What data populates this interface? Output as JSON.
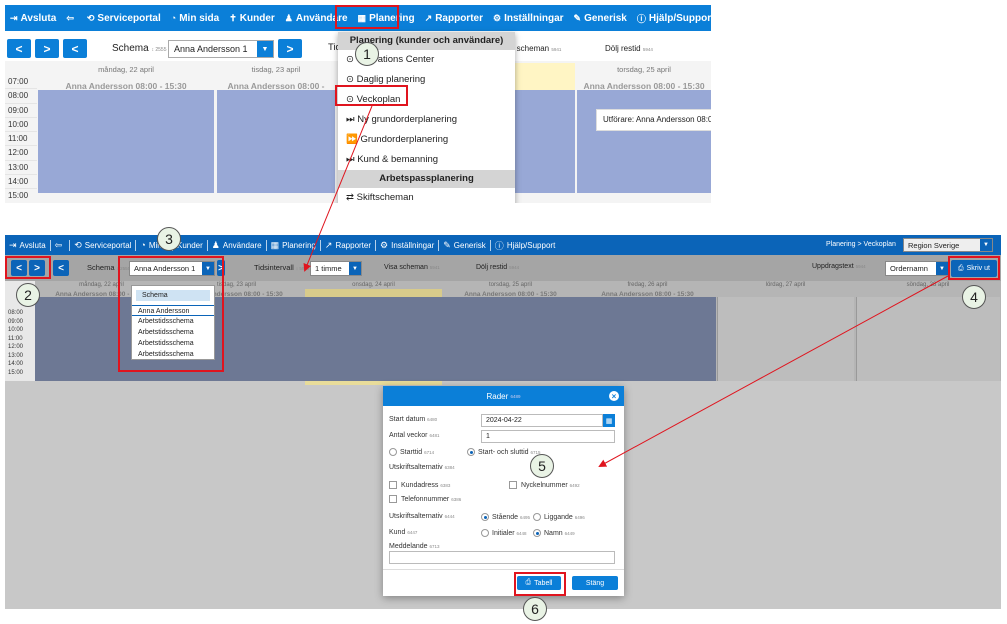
{
  "top": {
    "nav": [
      {
        "icon": "sign-out-icon",
        "glyph": "⇥",
        "label": "Avsluta"
      },
      {
        "icon": "back-arrow-icon",
        "glyph": "⇦",
        "label": ""
      },
      {
        "icon": "portal-icon",
        "glyph": "⟲",
        "label": "Serviceportal"
      },
      {
        "icon": "dashboard-icon",
        "glyph": "◔",
        "label": "Min sida"
      },
      {
        "icon": "customer-icon",
        "glyph": "✝",
        "label": "Kunder"
      },
      {
        "icon": "user-icon",
        "glyph": "♟",
        "label": "Användare"
      },
      {
        "icon": "calendar-icon",
        "glyph": "▦",
        "label": "Planering"
      },
      {
        "icon": "chart-icon",
        "glyph": "↗",
        "label": "Rapporter"
      },
      {
        "icon": "cogs-icon",
        "glyph": "⚙",
        "label": "Inställningar"
      },
      {
        "icon": "wrench-icon",
        "glyph": "✎",
        "label": "Generisk"
      },
      {
        "icon": "info-icon",
        "glyph": "ⓘ",
        "label": "Hjälp/Support"
      }
    ],
    "schema_label": "Schema",
    "schema_code": "2555",
    "schema_value": "Anna Andersson 1",
    "tids_partial": "Tids",
    "visa_partial": "a scheman",
    "visa_code": "5941",
    "dolj_label": "Dölj restid",
    "dolj_code": "5944",
    "days": [
      {
        "date": "måndag, 22 april",
        "name": "Anna Andersson 08:00 - 15:30"
      },
      {
        "date": "tisdag, 23 april",
        "name": "Anna Andersson 08:00 - 15:30"
      },
      {
        "date": "",
        "name": "0 - 15:30"
      },
      {
        "date": "torsdag, 25 april",
        "name": "Anna Andersson 08:00 - 15:30"
      }
    ],
    "times": [
      "07:00",
      "08:00",
      "09:00",
      "10:00",
      "11:00",
      "12:00",
      "13:00",
      "14:00",
      "15:00"
    ],
    "tooltip": "Utförare: Anna Andersson 08:00 -",
    "menu": {
      "header1": "Planering (kunder och användare)",
      "items1": [
        {
          "glyph": "⊙",
          "label": "Operations Center"
        },
        {
          "glyph": "⊙",
          "label": "Daglig planering"
        },
        {
          "glyph": "⊙",
          "label": "Veckoplan"
        },
        {
          "glyph": "⏭",
          "label": "Ny grundorderplanering"
        },
        {
          "glyph": "⏩",
          "label": "Grundorderplanering"
        },
        {
          "glyph": "⏭",
          "label": "Kund & bemanning"
        }
      ],
      "header2": "Arbetspassplanering",
      "items2": [
        {
          "glyph": "⇄",
          "label": "Skiftscheman"
        }
      ]
    }
  },
  "bottom": {
    "nav": [
      {
        "glyph": "⇥",
        "label": "Avsluta"
      },
      {
        "glyph": "⇦",
        "label": ""
      },
      {
        "glyph": "⟲",
        "label": "Serviceportal"
      },
      {
        "glyph": "◔",
        "label": "Min s"
      },
      {
        "glyph": "",
        "label": "Kunder"
      },
      {
        "glyph": "♟",
        "label": "Användare"
      },
      {
        "glyph": "▦",
        "label": "Planering"
      },
      {
        "glyph": "↗",
        "label": "Rapporter"
      },
      {
        "glyph": "⚙",
        "label": "Inställningar"
      },
      {
        "glyph": "✎",
        "label": "Generisk"
      },
      {
        "glyph": "ⓘ",
        "label": "Hjälp/Support"
      }
    ],
    "breadcrumb": "Planering > Veckoplan",
    "region": "Region Sverige",
    "schema_label": "Schema",
    "schema_code": "2555",
    "schema_value": "Anna Andersson 1",
    "tids_label": "Tidsintervall",
    "tids_code": "5935",
    "tids_value": "1 timme",
    "visa_label": "Visa scheman",
    "visa_code": "5941",
    "dolj_label": "Dölj restid",
    "dolj_code": "5944",
    "uppdrag_label": "Uppdragstext",
    "uppdrag_code": "5944",
    "order_value": "Ordernamn",
    "print_label": "Skriv ut",
    "days": [
      {
        "date": "måndag, 22 april",
        "name": "Anna Andersson 08:00 - 15:30"
      },
      {
        "date": "tisdag, 23 april",
        "name": "Anna Andersson 08:00 - 15:30"
      },
      {
        "date": "onsdag, 24 april",
        "name": "Anna Andersson 08:00 - 15:30"
      },
      {
        "date": "torsdag, 25 april",
        "name": "Anna Andersson 08:00 - 15:30"
      },
      {
        "date": "fredag, 26 april",
        "name": "Anna Andersson 08:00 - 15:30"
      },
      {
        "date": "lördag, 27 april",
        "name": ""
      },
      {
        "date": "söndag, 28 april",
        "name": ""
      }
    ],
    "times": [
      "08:00",
      "09:00",
      "10:00",
      "11:00",
      "12:00",
      "13:00",
      "14:00",
      "15:00"
    ],
    "schema_dropdown": {
      "header": "Schema",
      "items": [
        "Anna Andersson",
        "Arbetstidsschema",
        "Arbetstidsschema",
        "Arbetstidsschema",
        "Arbetstidsschema"
      ]
    },
    "modal": {
      "title": "Rader",
      "title_code": "6489",
      "start_label": "Start datum",
      "start_code": "6480",
      "start_value": "2024-04-22",
      "weeks_label": "Antal veckor",
      "weeks_code": "6481",
      "weeks_value": "1",
      "radio_start": "Starttid",
      "radio_start_code": "6714",
      "radio_both": "Start- och sluttid",
      "radio_both_code": "6715",
      "opt_label": "Utskriftsalternativ",
      "opt_code": "6384",
      "kund_addr": "Kundadress",
      "kund_addr_code": "6383",
      "nyckel": "Nyckelnummer",
      "nyckel_code": "6492",
      "telefon": "Telefonnummer",
      "telefon_code": "6386",
      "opt2_label": "Utskriftsalternativ",
      "opt2_code": "6444",
      "staende": "Stående",
      "staende_code": "6495",
      "liggande": "Liggande",
      "liggande_code": "6496",
      "kund_label": "Kund",
      "kund_code": "6447",
      "initialer": "Initialer",
      "initialer_code": "6448",
      "namn": "Namn",
      "namn_code": "6449",
      "medd_label": "Meddelande",
      "medd_code": "6713",
      "tabell": "Tabell",
      "stang": "Stäng"
    }
  },
  "steps": [
    "1",
    "2",
    "3",
    "4",
    "5",
    "6"
  ],
  "colors": {
    "nav": "#0b7fd8",
    "highlight": "#e0141e",
    "block": "#98a8d6"
  }
}
